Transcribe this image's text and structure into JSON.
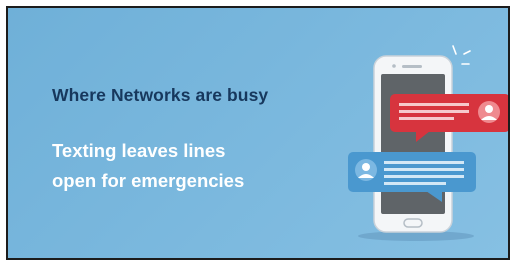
{
  "banner": {
    "headline": "Where Networks are busy",
    "subline_1": "Texting leaves lines",
    "subline_2": "open for emergencies"
  },
  "icons": {
    "phone": "smartphone-icon",
    "incoming_message": "red-chat-bubble-with-user-icon",
    "outgoing_message": "blue-chat-bubble-with-user-icon",
    "notification_sparkle": "sparkle-lines-icon"
  },
  "colors": {
    "background": "#79b7dd",
    "headline": "#17385d",
    "subline": "#ffffff",
    "red_bubble": "#d7343e",
    "blue_bubble": "#4a98cf",
    "phone_body": "#f4f6f8",
    "phone_screen": "#5f6468"
  }
}
